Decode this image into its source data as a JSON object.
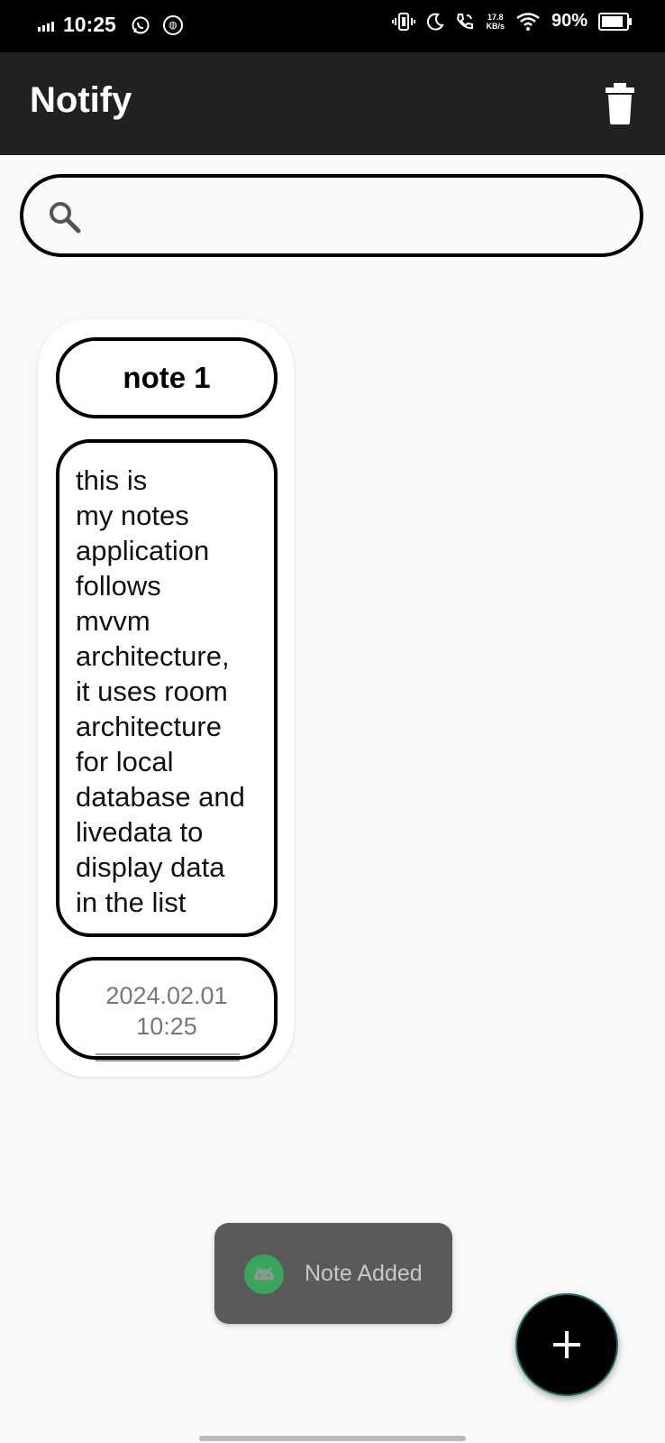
{
  "status_bar": {
    "time": "10:25",
    "network_speed_value": "17.8",
    "network_speed_unit": "KB/s",
    "battery_percent": "90%",
    "battery_level": 0.9,
    "icons": [
      "signal-icon",
      "whatsapp-icon",
      "app-notification-icon",
      "vibrate-icon",
      "do-not-disturb-icon",
      "wifi-calling-icon",
      "wifi-icon",
      "battery-icon"
    ]
  },
  "app_bar": {
    "title": "Notify",
    "action_icon": "trash-icon"
  },
  "search": {
    "placeholder": "",
    "value": "",
    "icon": "search-icon"
  },
  "notes": [
    {
      "title": "note 1",
      "body_lines": [
        "this is",
        "my notes",
        "application",
        "follows",
        "mvvm",
        "architecture,",
        "it uses room",
        "architecture",
        "for local",
        "database and",
        "livedata to",
        "display data",
        "in the list"
      ],
      "date": "2024.02.01",
      "time": "10:25"
    }
  ],
  "toast": {
    "message": "Note Added",
    "icon": "android-icon"
  },
  "fab": {
    "icon": "plus-icon"
  },
  "colors": {
    "app_bar": "#212121",
    "status_bar": "#000000",
    "background": "#f9f9f9",
    "card": "#ffffff",
    "border": "#000000",
    "toast": "#5a5a5a",
    "toast_icon": "#3aa55c",
    "fab": "#000000",
    "fab_border": "#1e6e66"
  }
}
